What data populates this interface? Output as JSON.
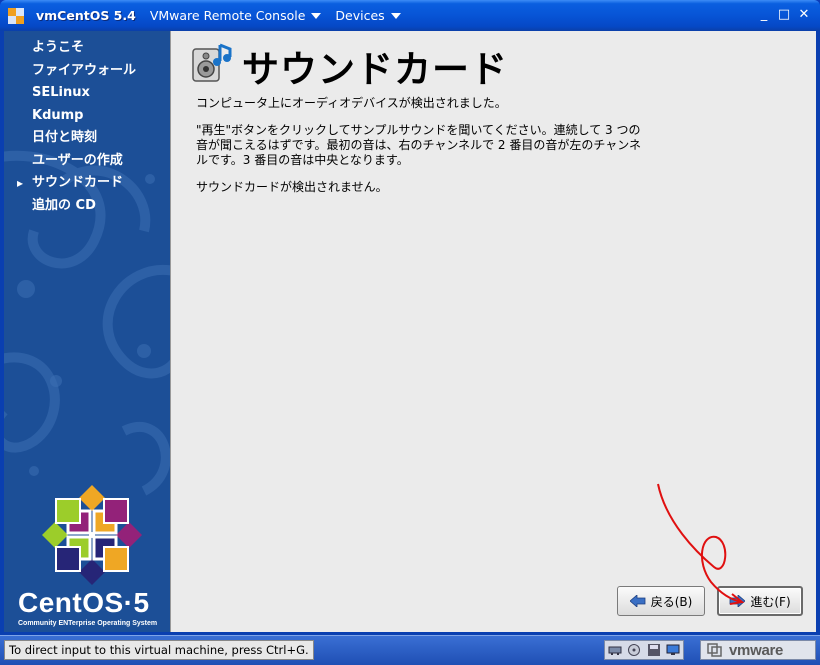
{
  "titlebar": {
    "vm_name": "vmCentOS 5.4",
    "app_menu": "VMware Remote Console",
    "devices_menu": "Devices",
    "minimize_glyph": "_",
    "maximize_glyph": "□",
    "close_glyph": "✕"
  },
  "sidebar": {
    "current_bullet": "▸",
    "steps": [
      {
        "label": "ようこそ",
        "current": false
      },
      {
        "label": "ファイアウォール",
        "current": false
      },
      {
        "label": "SELinux",
        "current": false
      },
      {
        "label": "Kdump",
        "current": false
      },
      {
        "label": "日付と時刻",
        "current": false
      },
      {
        "label": "ユーザーの作成",
        "current": false
      },
      {
        "label": "サウンドカード",
        "current": true
      },
      {
        "label": "追加の CD",
        "current": false
      }
    ],
    "logo_text": "CentOS·5",
    "logo_tagline": "Community ENTerprise Operating System"
  },
  "content": {
    "title": "サウンドカード",
    "detected_text": "コンピュータ上にオーディオデバイスが検出されました。",
    "instruction_line1": "\"再生\"ボタンをクリックしてサンプルサウンドを聞いてください。連続して 3 つの",
    "instruction_line2": "音が聞こえるはずです。最初の音は、右のチャンネルで 2 番目の音が左のチャンネ",
    "instruction_line3": "ルです。3 番目の音は中央となります。",
    "not_detected_text": "サウンドカードが検出されません。",
    "back_button": "戻る(B)",
    "forward_button": "進む(F)"
  },
  "statusbar": {
    "hint": "To direct input to this virtual machine, press Ctrl+G.",
    "brand": "vmware"
  },
  "icons": {
    "app": "vmware-app-icon",
    "page": "sound-card-icon",
    "back": "left-arrow-icon",
    "forward": "right-arrow-icon",
    "status_devices": [
      "network-adapter-icon",
      "cd-rom-icon",
      "floppy-icon",
      "display-icon"
    ]
  },
  "colors": {
    "titlebar": "#0754d6",
    "sidebar": "#1c4f97",
    "content_bg": "#ebebeb",
    "statusbar": "#2a5cc4"
  }
}
